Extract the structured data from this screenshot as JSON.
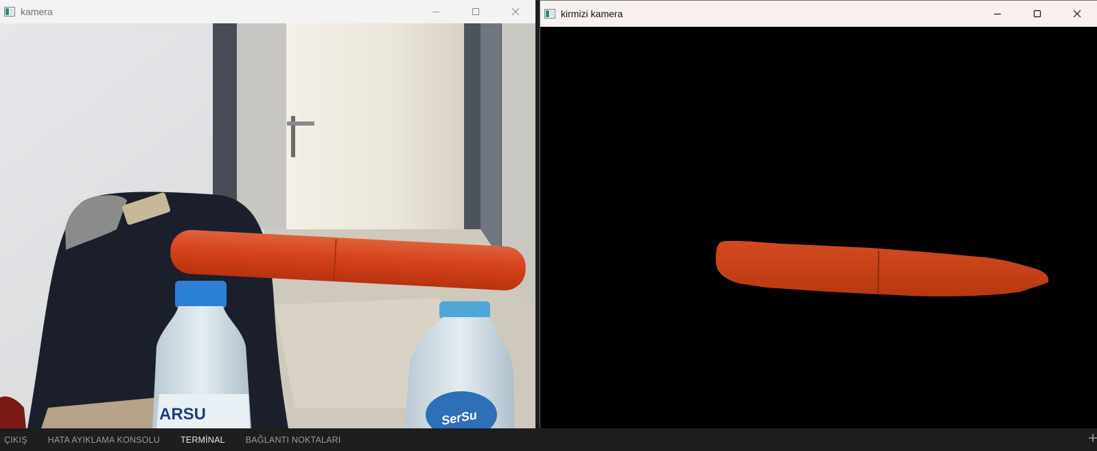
{
  "windows": {
    "left": {
      "title": "kamera",
      "icon": "opencv-window-icon"
    },
    "right": {
      "title": "kirmizi kamera",
      "icon": "opencv-window-icon"
    }
  },
  "controls": {
    "minimize": "minimize-icon",
    "maximize": "maximize-icon",
    "close": "close-icon"
  },
  "camera_feed": {
    "bottle_label_left": "ARSU",
    "bottle_label_right": "SerSu"
  },
  "panel": {
    "tabs": [
      {
        "label": "ÇIKIŞ",
        "active": false
      },
      {
        "label": "HATA AYIKLAMA KONSOLU",
        "active": false
      },
      {
        "label": "TERMİNAL",
        "active": true
      },
      {
        "label": "BAĞLANTI NOKTALARI",
        "active": false
      }
    ]
  },
  "colors": {
    "red_object": "#d8451c",
    "mask_background": "#000000",
    "panel_background": "#1e1e1e"
  }
}
